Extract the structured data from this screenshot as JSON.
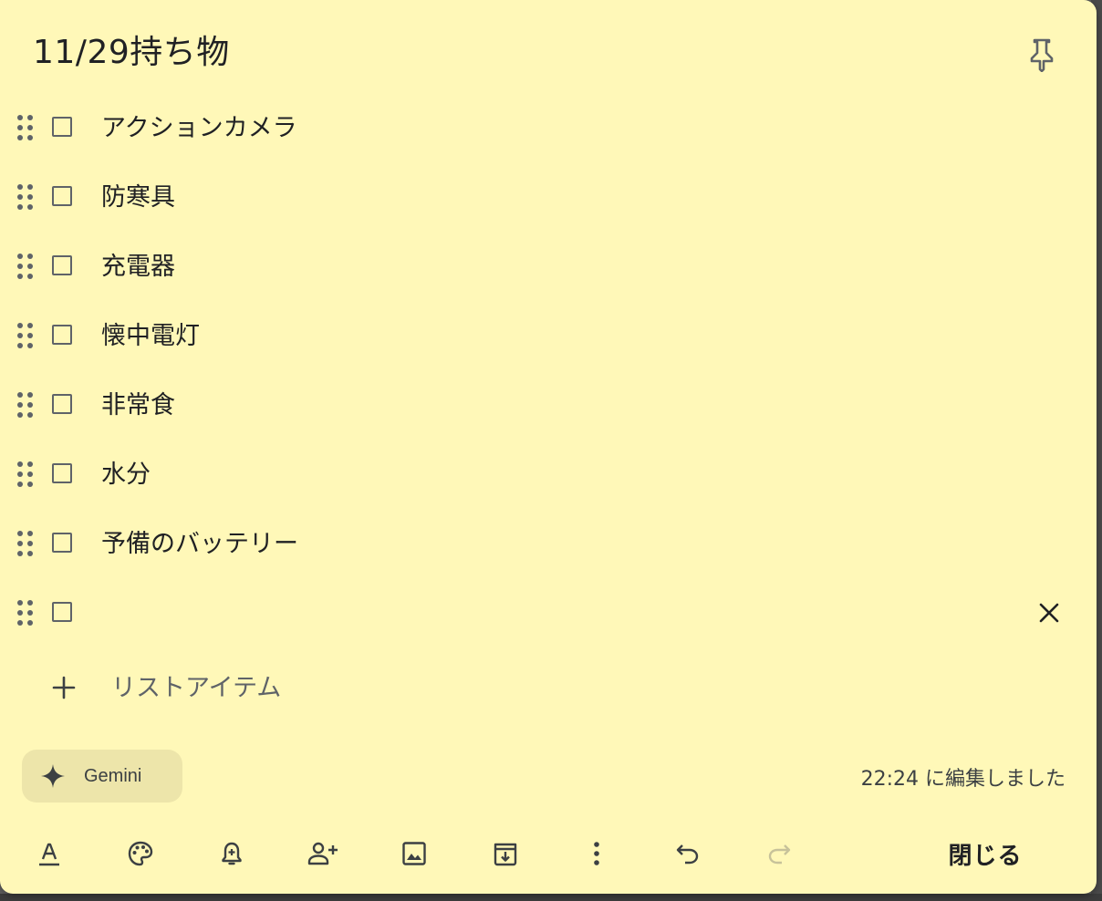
{
  "note": {
    "title": "11/29持ち物",
    "items": [
      {
        "text": "アクションカメラ",
        "checked": false
      },
      {
        "text": "防寒具",
        "checked": false
      },
      {
        "text": "充電器",
        "checked": false
      },
      {
        "text": "懐中電灯",
        "checked": false
      },
      {
        "text": "非常食",
        "checked": false
      },
      {
        "text": "水分",
        "checked": false
      },
      {
        "text": "予備のバッテリー",
        "checked": false
      },
      {
        "text": "",
        "checked": false
      }
    ],
    "add_item_label": "リストアイテム",
    "gemini_label": "Gemini",
    "edited_text": "22:24 に編集しました",
    "close_label": "閉じる"
  },
  "toolbar": {
    "icons": [
      "text-format-icon",
      "palette-icon",
      "add-reminder-icon",
      "add-collaborator-icon",
      "image-icon",
      "archive-icon",
      "more-vert-icon",
      "undo-icon",
      "redo-icon"
    ]
  },
  "colors": {
    "note_background": "#fff8b8",
    "gemini_chip": "#ede5aa",
    "text": "#202124",
    "icon": "#5f6368",
    "disabled_icon": "#c7c29a"
  }
}
